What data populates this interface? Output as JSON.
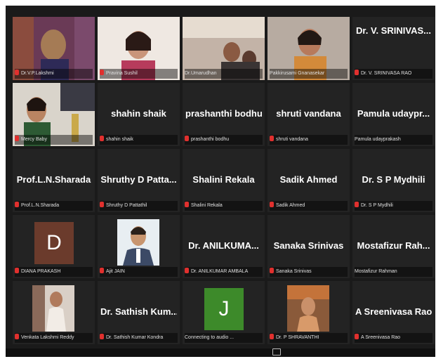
{
  "participants": [
    {
      "name": "Dr.V.P.Lakshmi",
      "tile": "video"
    },
    {
      "name": "Pravina Sushil",
      "tile": "video"
    },
    {
      "name": "Dr.Umarudhan",
      "tile": "video"
    },
    {
      "name": "Pakkirusami Gnanasekar",
      "tile": "video"
    },
    {
      "name": "Dr. V. SRINIVAS...",
      "tag": "Dr. V. SRINIVASA RAO",
      "tile": "name"
    },
    {
      "name": "Mercy Baby",
      "tile": "video"
    },
    {
      "name": "shahin shaik",
      "tag": "shahin shaik",
      "tile": "name"
    },
    {
      "name": "prashanthi bodhu",
      "tag": "prashanthi bodhu",
      "tile": "name"
    },
    {
      "name": "shruti vandana",
      "tag": "shruti vandana",
      "tile": "name"
    },
    {
      "name": "Pamula udaypr...",
      "tag": "Pamula udayprakash",
      "tile": "name"
    },
    {
      "name": "Prof.L.N.Sharada",
      "tag": "Prof.L.N.Sharada",
      "tile": "name"
    },
    {
      "name": "Shruthy D Patta...",
      "tag": "Shruthy D Pattathil",
      "tile": "name"
    },
    {
      "name": "Shalini Rekala",
      "tag": "Shalini Rekala",
      "tile": "name"
    },
    {
      "name": "Sadik Ahmed",
      "tag": "Sadik Ahmed",
      "tile": "name"
    },
    {
      "name": "Dr. S P Mydhili",
      "tag": "Dr. S P Mydhili",
      "tile": "name"
    },
    {
      "name": "DIANA PRAKASH",
      "letter": "D",
      "tile": "letter"
    },
    {
      "name": "Ajit JAIN",
      "tile": "video"
    },
    {
      "name": "Dr. ANILKUMA...",
      "tag": "Dr. ANILKUMAR AMBALA",
      "tile": "name"
    },
    {
      "name": "Sanaka Srinivas",
      "tag": "Sanaka Srinivas",
      "tile": "name"
    },
    {
      "name": "Mostafizur Rah...",
      "tag": "Mostafizur Rahman",
      "tile": "name"
    },
    {
      "name": "Venkata Lakshmi Reddy",
      "tile": "video"
    },
    {
      "name": "Dr. Sathish Kum...",
      "tag": "Dr. Sathish Kumar Kondra",
      "tile": "name"
    },
    {
      "name": "Connecting to audio ...",
      "letter": "J",
      "tile": "letter"
    },
    {
      "name": "Dr. P SHRAVANTHI",
      "tile": "video"
    },
    {
      "name": "A Sreenivasa Rao",
      "tag": "A Sreenivasa Rao",
      "tile": "name"
    }
  ],
  "colors": {
    "active": "#d9d84a",
    "muted_mic": "#e0302e",
    "letter_D": "#6b3b2c",
    "letter_J": "#3d8a2a"
  }
}
